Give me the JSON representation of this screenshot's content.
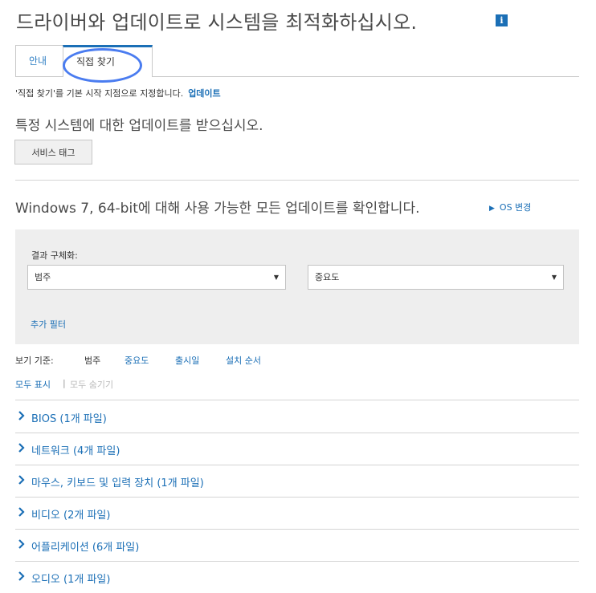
{
  "header": {
    "title": "드라이버와 업데이트로 시스템을 최적화하십시오.",
    "info_icon": "i"
  },
  "tabs": [
    {
      "label": "안내"
    },
    {
      "label": "직접 찾기"
    }
  ],
  "default_note": {
    "text": "'직접 찾기'를 기본 시작 지점으로 지정합니다.",
    "link": "업데이트"
  },
  "specific": {
    "heading": "특정 시스템에 대한 업데이트를 받으십시오.",
    "button": "서비스 태그"
  },
  "os": {
    "heading": "Windows 7, 64-bit에 대해 사용 가능한 모든 업데이트를 확인합니다.",
    "change_link": "OS 변경"
  },
  "filters": {
    "label": "결과 구체화:",
    "category_select": "범주",
    "importance_select": "중요도",
    "more": "추가 필터"
  },
  "sort": {
    "label": "보기 기준:",
    "current": "범주",
    "options": [
      "중요도",
      "출시일",
      "설치 순서"
    ]
  },
  "toggle": {
    "show_all": "모두 표시",
    "separator": "|",
    "hide_all": "모두 숨기기"
  },
  "categories": [
    {
      "label": "BIOS (1개 파일)"
    },
    {
      "label": "네트워크 (4개 파일)"
    },
    {
      "label": "마우스, 키보드 및 입력 장치 (1개 파일)"
    },
    {
      "label": "비디오 (2개 파일)"
    },
    {
      "label": "어플리케이션 (6개 파일)"
    },
    {
      "label": "오디오 (1개 파일)"
    }
  ],
  "colors": {
    "link": "#1b6fb6",
    "annotation": "#4a7cf0"
  }
}
